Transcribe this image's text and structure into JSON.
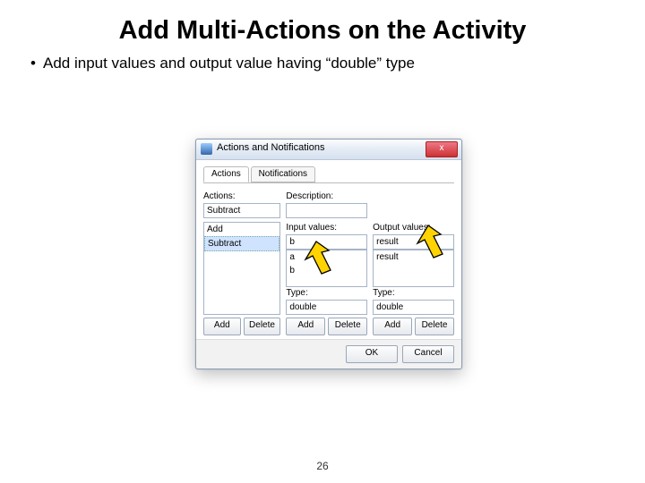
{
  "title": "Add Multi-Actions on the Activity",
  "bullet": "Add input values and output value having “double” type",
  "page_number": "26",
  "dialog": {
    "title": "Actions and Notifications",
    "close": "x",
    "tabs": {
      "actions": "Actions",
      "notifications": "Notifications"
    },
    "labels": {
      "actions": "Actions:",
      "description": "Description:",
      "input": "Input values:",
      "output": "Output values:",
      "type": "Type:"
    },
    "action_field": "Subtract",
    "action_list": [
      "Add",
      "Subtract"
    ],
    "input_field": "b",
    "input_list": [
      "a",
      "b"
    ],
    "output_field": "result",
    "output_list": [
      "result"
    ],
    "type_value": "double",
    "buttons": {
      "add": "Add",
      "delete": "Delete",
      "ok": "OK",
      "cancel": "Cancel"
    }
  }
}
